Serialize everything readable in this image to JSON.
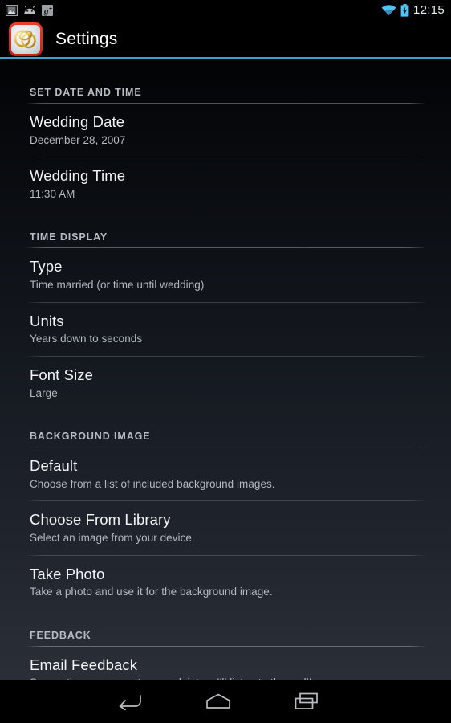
{
  "status_bar": {
    "notification_icons": [
      "image-icon",
      "android-head-icon",
      "google-plus-icon"
    ],
    "google_plus_label": "g",
    "wifi_icon": "wifi-icon",
    "battery_icon": "battery-charging-icon",
    "clock": "12:15",
    "accent_color": "#4fc3f7"
  },
  "action_bar": {
    "app_icon": "wedding-rings-app-icon",
    "title": "Settings",
    "accent_color": "#3d9fd4",
    "icon_border_color": "#d4301c"
  },
  "sections": [
    {
      "header": "SET DATE AND TIME",
      "items": [
        {
          "title": "Wedding Date",
          "summary": "December 28, 2007",
          "name": "wedding-date"
        },
        {
          "title": "Wedding Time",
          "summary": "11:30 AM",
          "name": "wedding-time"
        }
      ]
    },
    {
      "header": "TIME DISPLAY",
      "items": [
        {
          "title": "Type",
          "summary": "Time married (or time until wedding)",
          "name": "type"
        },
        {
          "title": "Units",
          "summary": "Years down to seconds",
          "name": "units"
        },
        {
          "title": "Font Size",
          "summary": "Large",
          "name": "font-size"
        }
      ]
    },
    {
      "header": "BACKGROUND IMAGE",
      "items": [
        {
          "title": "Default",
          "summary": "Choose from a list of included background images.",
          "name": "default-background"
        },
        {
          "title": "Choose From Library",
          "summary": "Select an image from your device.",
          "name": "choose-from-library"
        },
        {
          "title": "Take Photo",
          "summary": "Take a photo and use it for the background image.",
          "name": "take-photo"
        }
      ]
    },
    {
      "header": "FEEDBACK",
      "items": [
        {
          "title": "Email Feedback",
          "summary": "Suggestions, comments, complaints... I'll listen to them all!",
          "name": "email-feedback"
        }
      ]
    }
  ],
  "nav_bar": {
    "buttons": [
      "back-icon",
      "home-icon",
      "recents-icon"
    ]
  }
}
